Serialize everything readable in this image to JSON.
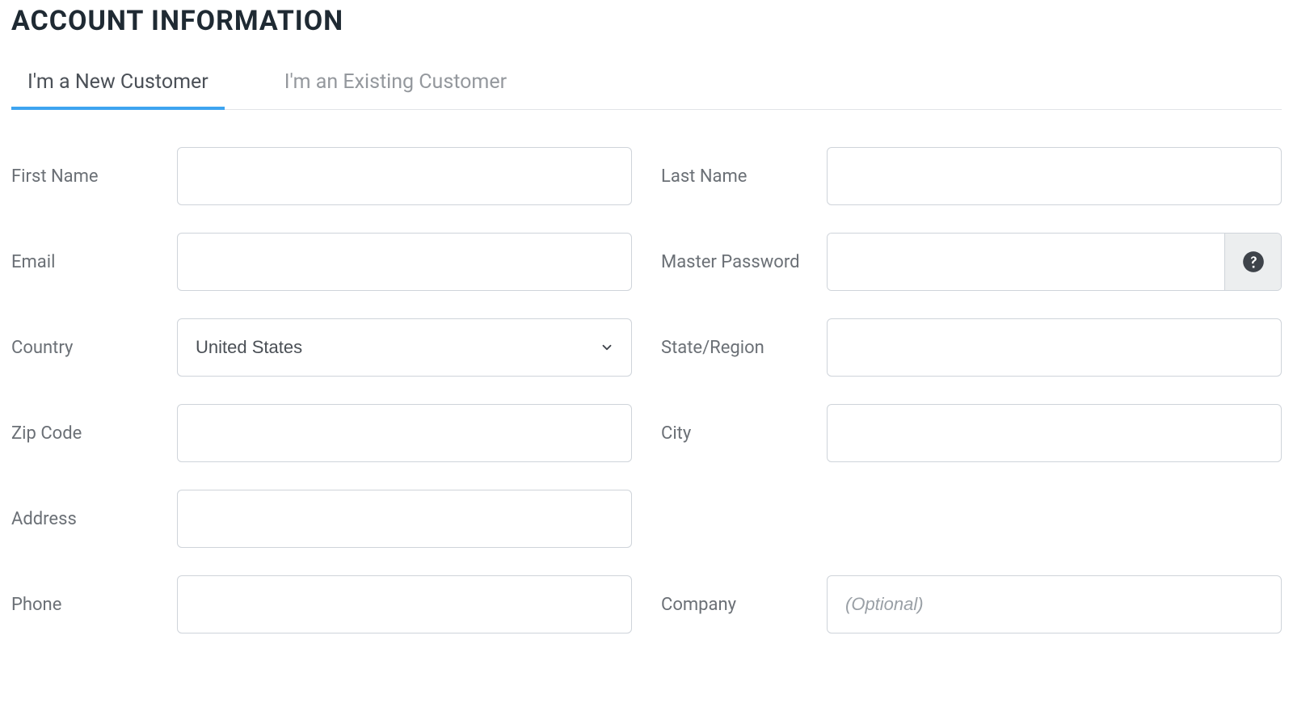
{
  "page_title": "ACCOUNT INFORMATION",
  "tabs": [
    {
      "label": "I'm a New Customer",
      "active": true
    },
    {
      "label": "I'm an Existing Customer",
      "active": false
    }
  ],
  "fields": {
    "first_name": {
      "label": "First Name",
      "value": "",
      "placeholder": ""
    },
    "last_name": {
      "label": "Last Name",
      "value": "",
      "placeholder": ""
    },
    "email": {
      "label": "Email",
      "value": "",
      "placeholder": ""
    },
    "master_password": {
      "label": "Master Password",
      "value": "",
      "placeholder": ""
    },
    "country": {
      "label": "Country",
      "value": "United States"
    },
    "state_region": {
      "label": "State/Region",
      "value": "",
      "placeholder": ""
    },
    "zip_code": {
      "label": "Zip Code",
      "value": "",
      "placeholder": ""
    },
    "city": {
      "label": "City",
      "value": "",
      "placeholder": ""
    },
    "address": {
      "label": "Address",
      "value": "",
      "placeholder": ""
    },
    "phone": {
      "label": "Phone",
      "value": "",
      "placeholder": ""
    },
    "company": {
      "label": "Company",
      "value": "",
      "placeholder": "(Optional)"
    }
  },
  "icons": {
    "chevron_down": "chevron-down-icon",
    "help": "question-circle-icon"
  },
  "colors": {
    "accent": "#3ea4f0",
    "border": "#cfd4da",
    "text_muted": "#6b7076",
    "heading": "#1f2a33"
  }
}
